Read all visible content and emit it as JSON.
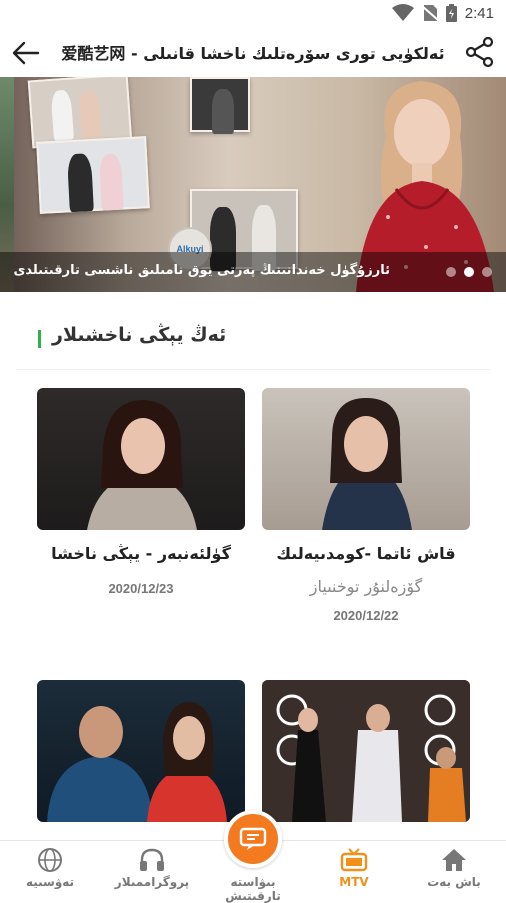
{
  "status": {
    "time": "2:41"
  },
  "header": {
    "title": "爱酷艺网 - ئەلكۈيى تورى سۆرەتلىك ناخشا قانىلى"
  },
  "banner": {
    "caption": "ئارزۇگۈل خەندانىنىڭ پەرتى يوق نامىلىق ناشسى تارقىتىلدى",
    "logo_text": "Alkuyi",
    "slide_count": 3,
    "active_slide": 2
  },
  "section": {
    "title": "ئەڭ يېڭى ناخشىلار"
  },
  "cards": [
    {
      "title": "قاش ئاتما -كومدىيەلىك",
      "subtitle": "گۆزەلنۇر توخنىياز",
      "date": "2020/12/22"
    },
    {
      "title": "گۈلئەنبەر - يېڭى ناخشا",
      "subtitle": "",
      "date": "2020/12/23"
    },
    {
      "title": "",
      "subtitle": "",
      "date": ""
    },
    {
      "title": "",
      "subtitle": "",
      "date": ""
    }
  ],
  "nav": {
    "items": [
      {
        "label": "باش بەت",
        "icon": "home-icon"
      },
      {
        "label": "MTV",
        "icon": "tv-icon"
      },
      {
        "label": "بىۋاستە تارقىتىش",
        "icon": "live-icon"
      },
      {
        "label": "پروگراممىلار",
        "icon": "headphones-icon"
      },
      {
        "label": "تەۋسىيە",
        "icon": "globe-icon"
      }
    ],
    "active": "MTV"
  },
  "colors": {
    "accent": "#f39019",
    "fab": "#f47a20",
    "section_bar": "#2fb24a"
  }
}
